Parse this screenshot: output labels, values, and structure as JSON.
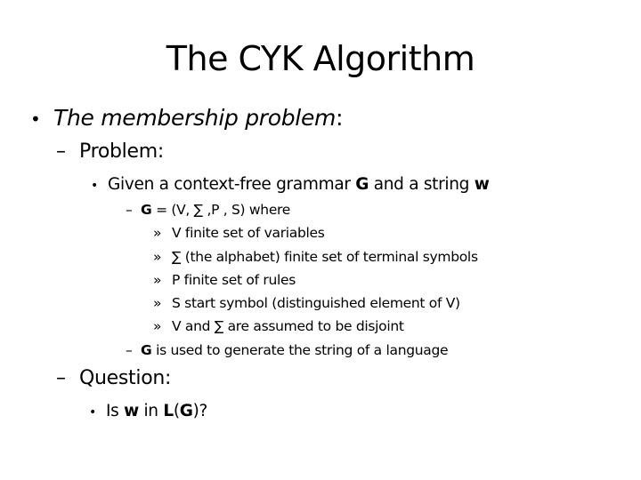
{
  "slide": {
    "title": "The CYK Algorithm",
    "level1": {
      "bullet": "•",
      "text_italic": "The membership problem",
      "suffix": ":"
    },
    "problem": {
      "dash": "–",
      "label": "Problem:"
    },
    "given": {
      "bullet": "•",
      "part1": "Given a context-free grammar ",
      "g": "G",
      "part2": " and a string ",
      "w": "w"
    },
    "grammar_def": {
      "dash": "–",
      "g": "G",
      "text": " = (V, ∑ ,P , S) where"
    },
    "components": [
      {
        "marker": "»",
        "text": "V finite set of variables"
      },
      {
        "marker": "»",
        "text": "∑ (the alphabet) finite set of terminal symbols"
      },
      {
        "marker": "»",
        "text": "P finite set of rules"
      },
      {
        "marker": "»",
        "text": "S start symbol (distinguished element of V)"
      },
      {
        "marker": "»",
        "text": "V and ∑ are assumed to be disjoint"
      }
    ],
    "g_usage": {
      "dash": "–",
      "g": "G",
      "text": " is used to generate the string of a language"
    },
    "question": {
      "dash": "–",
      "label": "Question:"
    },
    "question_item": {
      "bullet": "•",
      "part1": "Is ",
      "w": "w",
      "part2": " in ",
      "l": "L",
      "paren_open": "(",
      "g": "G",
      "paren_close": ")?"
    }
  }
}
